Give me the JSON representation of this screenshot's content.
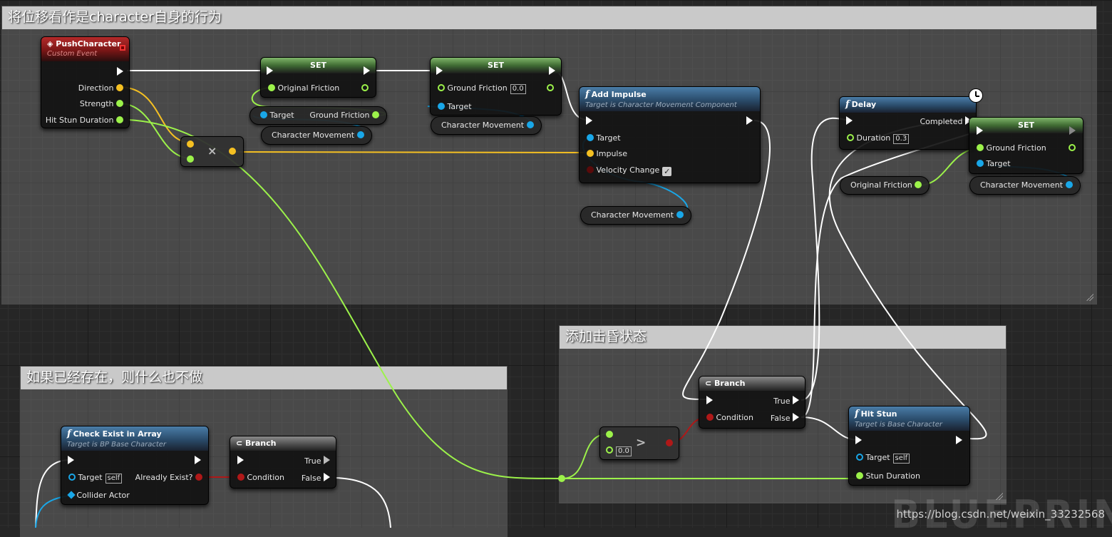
{
  "comments": {
    "top": "将位移看作是character自身的行为",
    "bottom_left": "如果已经存在，则什么也不做",
    "bottom_right": "添加击昏状态"
  },
  "push_character": {
    "title": "PushCharacter",
    "subtitle": "Custom Event",
    "pins": {
      "direction": "Direction",
      "strength": "Strength",
      "hit_stun": "Hit Stun Duration"
    }
  },
  "set1": {
    "title": "SET",
    "ground_friction_in": "Original Friction"
  },
  "getter_target_gf": {
    "target": "Target",
    "ground_friction": "Ground Friction"
  },
  "char_movement": "Character Movement",
  "multiply": {
    "symbol": "×"
  },
  "set2": {
    "title": "SET",
    "ground_friction": "Ground Friction",
    "value": "0.0",
    "target": "Target"
  },
  "add_impulse": {
    "title": "Add Impulse",
    "subtitle": "Target is Character Movement Component",
    "target": "Target",
    "impulse": "Impulse",
    "velocity_change": "Velocity Change",
    "checkmark": "✓"
  },
  "delay": {
    "title": "Delay",
    "completed": "Completed",
    "duration": "Duration",
    "duration_value": "0.3"
  },
  "set3": {
    "title": "SET",
    "ground_friction": "Ground Friction",
    "target": "Target"
  },
  "original_friction_getter": "Original Friction",
  "check_exist": {
    "title": "Check Exist in Array",
    "subtitle": "Target is BP Base Character",
    "target": "Target",
    "self": "self",
    "already_exist": "Alreadly Exist?",
    "collider_actor": "Collider Actor"
  },
  "branch1": {
    "title": "Branch",
    "true": "True",
    "false": "False",
    "condition": "Condition"
  },
  "branch2": {
    "title": "Branch",
    "true": "True",
    "false": "False",
    "condition": "Condition"
  },
  "greater": {
    "symbol": ">",
    "value": "0.0"
  },
  "hit_stun": {
    "title": "Hit Stun",
    "subtitle": "Target is Base Character",
    "target": "Target",
    "self": "self",
    "stun_duration": "Stun Duration"
  },
  "watermark": {
    "logo": "BLUEPRINT",
    "url": "https://blog.csdn.net/weixin_33232568"
  },
  "colors": {
    "exec": "#ffffff",
    "float": "#9cf24a",
    "vector": "#f5c022",
    "object": "#19a7e8",
    "bool": "#8a0e0e"
  }
}
